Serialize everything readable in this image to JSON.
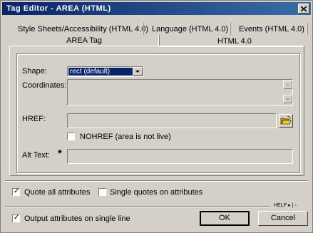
{
  "window": {
    "title": "Tag Editor - AREA  (HTML)"
  },
  "tabs": {
    "top_row": [
      {
        "label": "Style Sheets/Accessibility (HTML 4.0)"
      },
      {
        "label": "Language (HTML 4.0)"
      },
      {
        "label": "Events (HTML 4.0)"
      }
    ],
    "bottom_row": [
      {
        "label": "AREA Tag",
        "active": true
      },
      {
        "label": "HTML 4.0"
      }
    ]
  },
  "form": {
    "shape_label": "Shape:",
    "shape_value": "rect (default)",
    "coordinates_label": "Coordinates:",
    "href_label": "HREF:",
    "nohref_label": "NOHREF (area is not live)",
    "alt_text_label": "Alt Text:",
    "required_marker": "*"
  },
  "options": {
    "quote_all_label": "Quote all attributes",
    "quote_all_checked": true,
    "single_quotes_label": "Single quotes on attributes",
    "single_quotes_checked": false,
    "output_single_line_label": "Output attributes on single line",
    "output_single_line_checked": true
  },
  "buttons": {
    "help_label": "HELP",
    "ok_label": "OK",
    "cancel_label": "Cancel"
  },
  "icons": {
    "close": "close-icon",
    "folder": "folder-open-icon",
    "dropdown": "chevron-down-icon"
  }
}
